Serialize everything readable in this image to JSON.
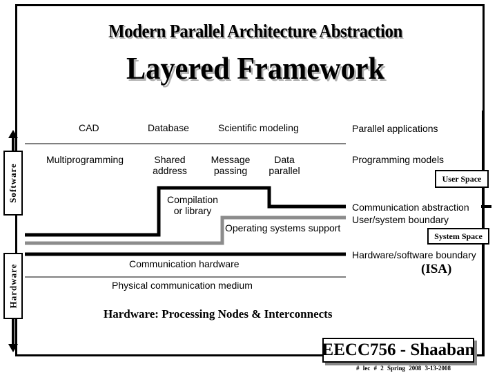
{
  "title": "Modern Parallel Architecture Abstraction",
  "subtitle": "Layered Framework",
  "side_labels": {
    "software": "Software",
    "hardware": "Hardware"
  },
  "applications": [
    "CAD",
    "Database",
    "Scientific modeling"
  ],
  "applications_layer": "Parallel applications",
  "programming_models": [
    "Multiprogramming",
    "Shared\naddress",
    "Message\npassing",
    "Data\nparallel"
  ],
  "programming_layer": "Programming models",
  "compilation": "Compilation\nor library",
  "os_support": "Operating systems support",
  "communication_abstraction": "Communication abstraction",
  "user_system_boundary": "User/system boundary",
  "user_space": "User Space",
  "system_space": "System Space",
  "hw_sw_boundary": "Hardware/software boundary",
  "isa": "(ISA)",
  "communication_hardware": "Communication hardware",
  "physical_medium": "Physical communication medium",
  "hardware_caption": "Hardware:  Processing Nodes & Interconnects",
  "footer": {
    "course": "EECC756 - Shaaban",
    "lecture": "#  lec # 2   Spring 2008  3-13-2008"
  },
  "colors": {
    "boundary_gray": "#8c8c8c",
    "line": "#000000"
  }
}
